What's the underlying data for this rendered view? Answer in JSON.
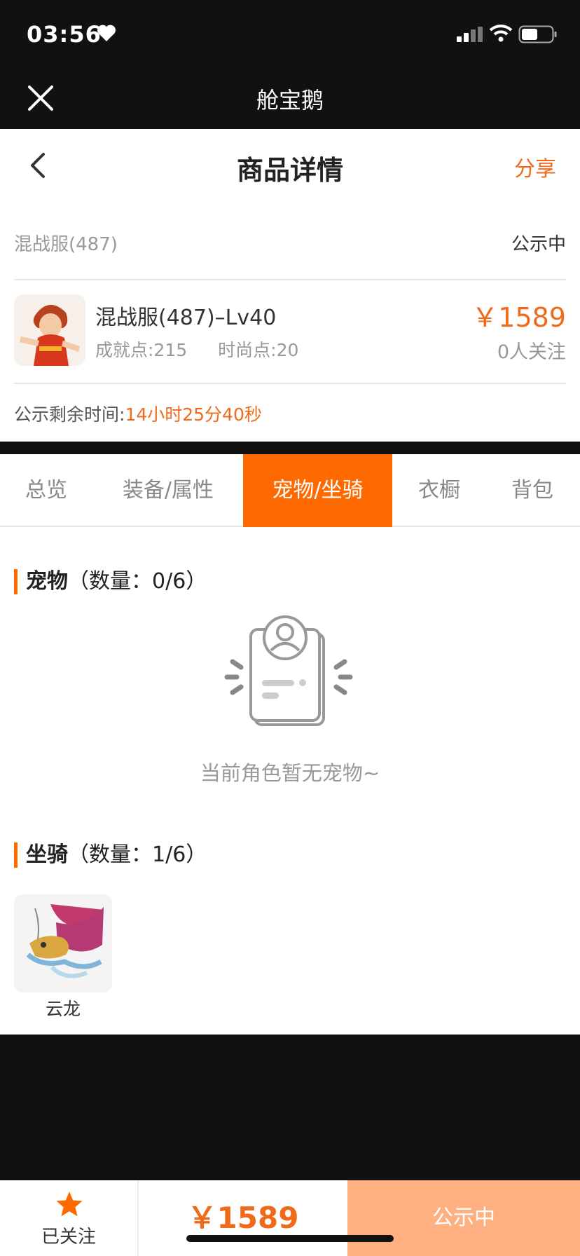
{
  "status_bar": {
    "time": "03:56"
  },
  "app_bar": {
    "title": "舱宝鹅"
  },
  "nav": {
    "title": "商品详情",
    "share": "分享"
  },
  "server": {
    "name": "混战服(487)",
    "state": "公示中"
  },
  "item": {
    "name": "混战服(487)–Lv40",
    "achievement": "成就点:215",
    "fashion": "时尚点:20",
    "price": "￥1589",
    "followers": "0人关注"
  },
  "remaining": {
    "label": "公示剩余时间:",
    "value": "14小时25分40秒"
  },
  "tabs": [
    {
      "label": "总览",
      "active": false
    },
    {
      "label": "装备/属性",
      "active": false
    },
    {
      "label": "宠物/坐骑",
      "active": true
    },
    {
      "label": "衣橱",
      "active": false
    },
    {
      "label": "背包",
      "active": false
    }
  ],
  "pets": {
    "title": "宠物",
    "count": "（数量：0/6）",
    "empty_text": "当前角色暂无宠物~"
  },
  "mounts": {
    "title": "坐骑",
    "count": "（数量：1/6）",
    "items": [
      {
        "name": "云龙"
      }
    ]
  },
  "bottom_bar": {
    "follow_label": "已关注",
    "price": "￥1589",
    "status": "公示中"
  },
  "colors": {
    "accent": "#ff6a00",
    "price": "#f06a1a",
    "status_button": "#ffb081"
  }
}
